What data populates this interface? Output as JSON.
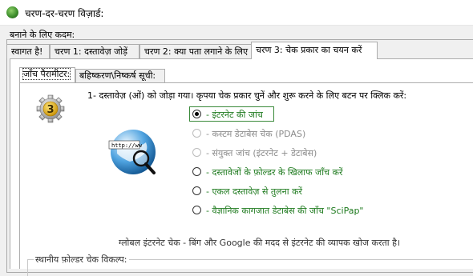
{
  "window": {
    "title": "चरण-दर-चरण विज़ार्ड:"
  },
  "section_label": "बनाने के लिए कदम:",
  "tabs": [
    {
      "label": "स्वागत है!"
    },
    {
      "label": "चरण 1: दस्तावेज़ जोड़ें"
    },
    {
      "label": "चरण 2: क्या पता लगाने के लिए"
    },
    {
      "label": "चरण 3: चेक प्रकार का चयन करें"
    }
  ],
  "subtabs": [
    {
      "label": "जाँच पैरामीटर:"
    },
    {
      "label": "बहिष्करण\\निष्कर्ष सूची:"
    }
  ],
  "step_number": "3",
  "instruction": "1- दस्तावेज़ (ओं) को जोड़ा गया। कृपया चेक प्रकार चुनें और शुरू करने के लिए बटन पर क्लिक करें:",
  "options": [
    {
      "label": "- इंटरनेट की जांच",
      "state": "checked"
    },
    {
      "label": "- कस्टम डेटाबेस चेक (PDAS)",
      "state": "disabled"
    },
    {
      "label": "- संयुक्त जांच (इंटरनेट + डेटाबेस)",
      "state": "disabled"
    },
    {
      "label": "- दस्तावेजों के फ़ोल्डर के खिलाफ जाँच करें",
      "state": "enabled"
    },
    {
      "label": "- एकल दस्तावेज़ से तुलना करें",
      "state": "enabled"
    },
    {
      "label": "- वैज्ञानिक कागजात डेटाबेस की जाँच \"SciPap\"",
      "state": "enabled"
    }
  ],
  "status_text": "ग्लोबल इंटरनेट चेक - बिंग और Google की मदद से इंटरनेट की व्यापक खोज करता है।",
  "folder_group_label": "स्थानीय फ़ोल्डर चेक विकल्प:",
  "colors": {
    "option_text": "#1e7a1e",
    "disabled_text": "#8c8c8c",
    "selection_border": "#3a8a3a"
  },
  "icons": {
    "app": "green-globe-icon",
    "step": "gear-step-icon",
    "globe": "internet-globe-magnifier-icon"
  }
}
